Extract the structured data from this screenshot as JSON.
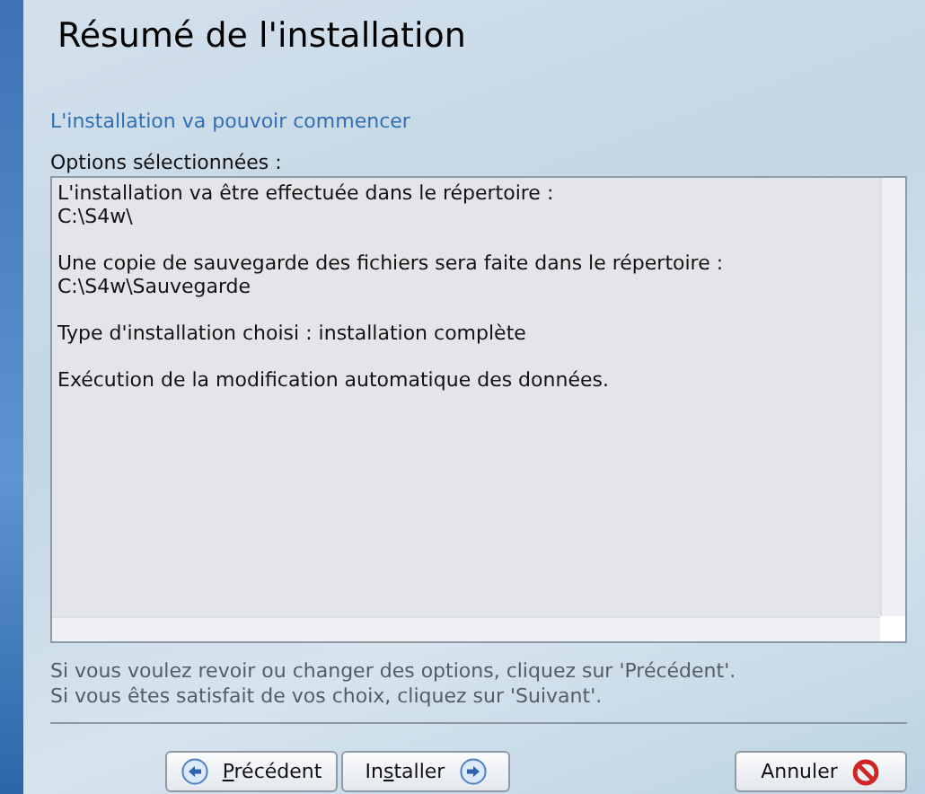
{
  "title": "Résumé de l'installation",
  "subtitle": "L'installation va pouvoir commencer",
  "options": {
    "label": "Options sélectionnées :",
    "paragraphs": [
      {
        "lines": [
          "L'installation va être effectuée dans le répertoire :",
          "C:\\S4w\\"
        ]
      },
      {
        "lines": [
          "Une copie de sauvegarde des fichiers sera faite dans le répertoire :",
          "C:\\S4w\\Sauvegarde"
        ]
      },
      {
        "lines": [
          "Type d'installation choisi : installation complète"
        ]
      },
      {
        "lines": [
          "Exécution de la modification automatique des données."
        ]
      }
    ]
  },
  "help": [
    "Si vous voulez revoir ou changer des options, cliquez sur 'Précédent'.",
    "Si vous êtes satisfait de vos choix, cliquez sur 'Suivant'."
  ],
  "buttons": [
    {
      "kind": "back",
      "key": "P",
      "after": "récédent"
    },
    {
      "kind": "next",
      "before": "In",
      "key": "s",
      "after": "taller"
    },
    {
      "kind": "cancel",
      "before": "Annuler"
    }
  ]
}
